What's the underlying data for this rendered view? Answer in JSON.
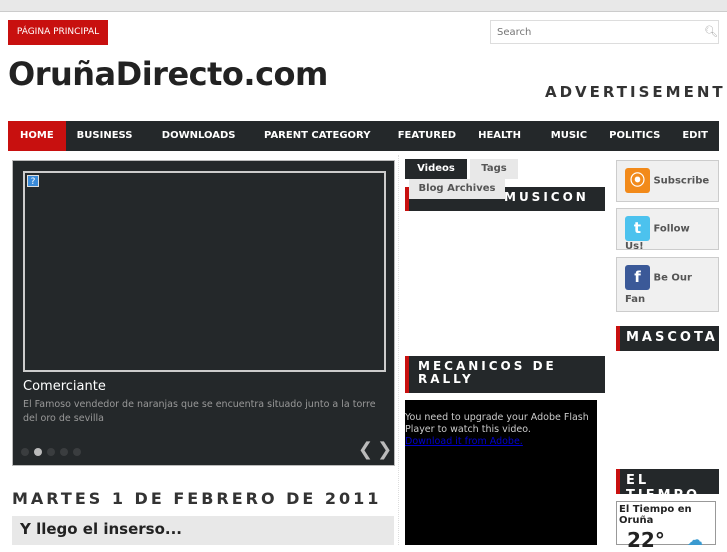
{
  "header": {
    "home_label": "PÁGINA PRINCIPAL",
    "search_placeholder": "Search",
    "site_title": "OruñaDirecto.com",
    "advertisement": "ADVERTISEMENT"
  },
  "nav": {
    "items": [
      "HOME",
      "BUSINESS »",
      "DOWNLOADS »",
      "PARENT CATEGORY »",
      "FEATURED",
      "HEALTH »",
      "MUSIC",
      "POLITICS",
      "EDIT"
    ]
  },
  "slider": {
    "title": "Comerciante",
    "description": "El Famoso vendedor de naranjas que se encuentra situado junto a la torre del oro de sevilla",
    "active_dot": 2,
    "dot_count": 5,
    "broken_image": "?"
  },
  "main": {
    "date_header": "MARTES 1 DE FEBRERO DE 2011",
    "post_title": "Y llego el inserso..."
  },
  "tabs": {
    "videos": "Videos",
    "tags": "Tags",
    "blog_archives": "Blog Archives"
  },
  "widgets": {
    "musicon": "MUSICON",
    "mecanicos": "MECANICOS DE RALLY",
    "mascota": "MASCOTA",
    "el_tiempo": "EL TIEMPO"
  },
  "flash": {
    "message": "You need to upgrade your Adobe Flash Player to watch this video.",
    "link": "Download it from Adobe."
  },
  "social": {
    "subscribe": "Subscribe",
    "follow": "Follow Us!",
    "fan": "Be Our Fan"
  },
  "weather": {
    "title": "El Tiempo en Oruña",
    "temp": "22°"
  },
  "colors": {
    "accent": "#c8100f",
    "dark": "#24282a"
  }
}
